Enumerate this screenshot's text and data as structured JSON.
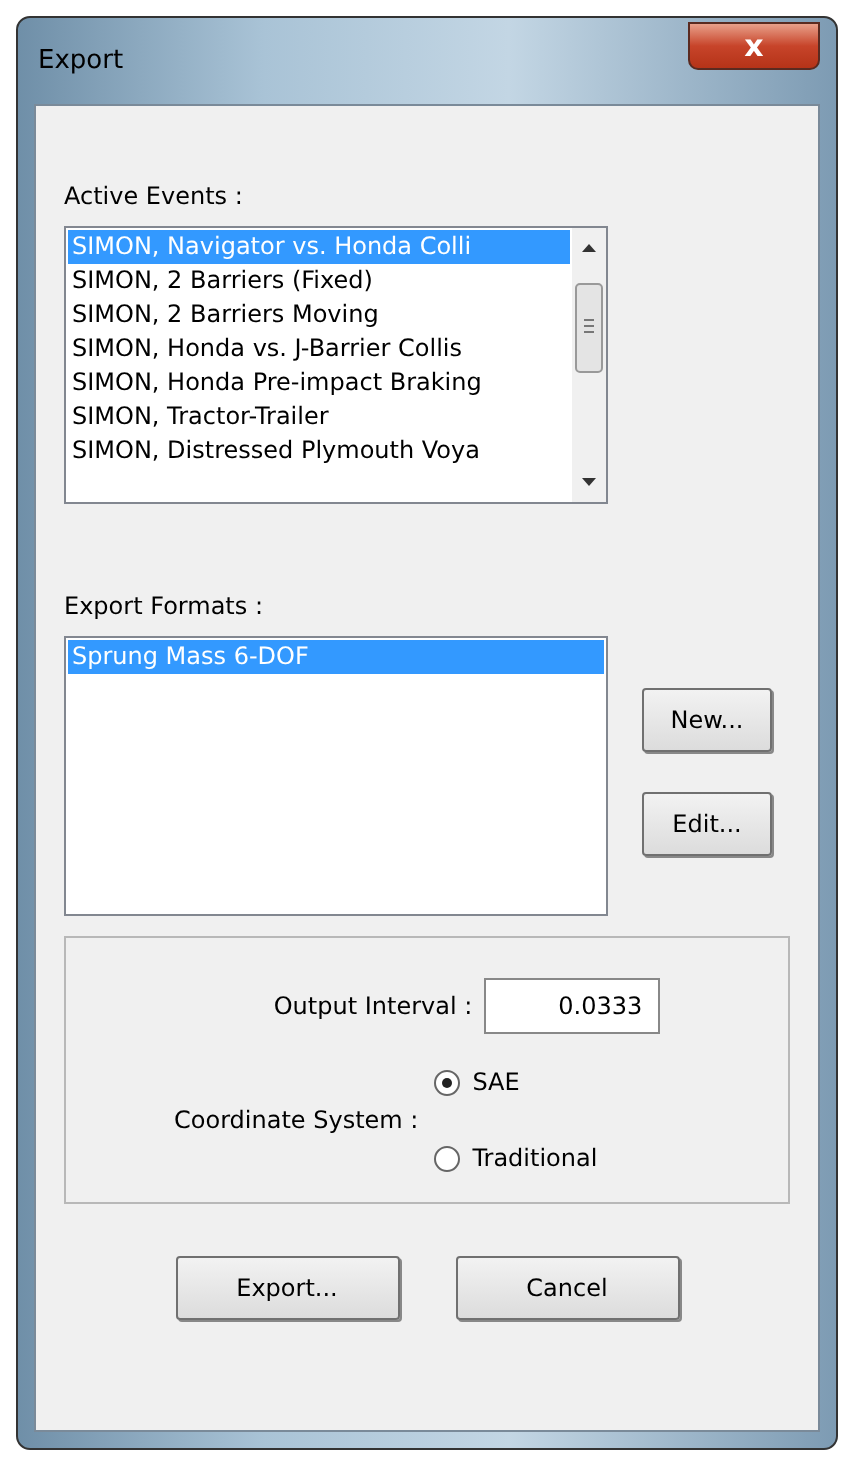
{
  "window": {
    "title": "Export",
    "close": "x"
  },
  "active_events": {
    "label": "Active Events :",
    "items": [
      {
        "text": "SIMON, Navigator vs. Honda Colli",
        "selected": true
      },
      {
        "text": "SIMON, 2 Barriers (Fixed)",
        "selected": false
      },
      {
        "text": "SIMON, 2 Barriers Moving",
        "selected": false
      },
      {
        "text": "SIMON, Honda vs. J-Barrier Collis",
        "selected": false
      },
      {
        "text": "SIMON, Honda Pre-impact Braking",
        "selected": false
      },
      {
        "text": "SIMON, Tractor-Trailer",
        "selected": false
      },
      {
        "text": "SIMON, Distressed Plymouth Voya",
        "selected": false
      }
    ]
  },
  "export_formats": {
    "label": "Export Formats :",
    "items": [
      {
        "text": "Sprung Mass 6-DOF",
        "selected": true
      }
    ],
    "buttons": [
      "New...",
      "Edit..."
    ]
  },
  "output_interval": {
    "label": "Output Interval :",
    "value": "0.0333"
  },
  "coordinate_system": {
    "label": "Coordinate System :",
    "options": [
      {
        "label": "SAE",
        "selected": true
      },
      {
        "label": "Traditional",
        "selected": false
      }
    ]
  },
  "buttons": [
    "Export...",
    "Cancel"
  ]
}
